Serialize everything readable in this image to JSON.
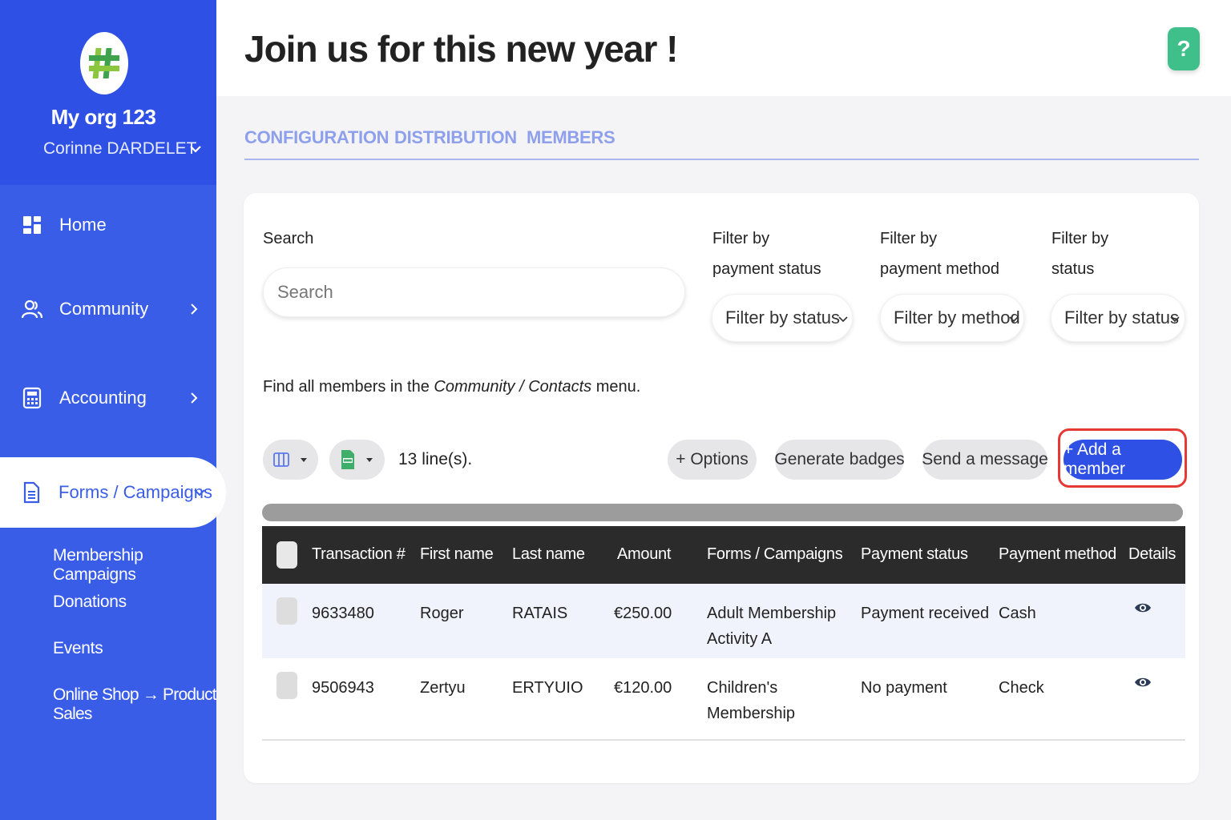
{
  "sidebar": {
    "org_name": "My org 123",
    "user_name": "Corinne DARDELET",
    "items": [
      {
        "label": "Home",
        "icon": "grid-icon"
      },
      {
        "label": "Community",
        "icon": "users-icon"
      },
      {
        "label": "Accounting",
        "icon": "calculator-icon"
      },
      {
        "label": "Forms / Campaigns",
        "icon": "document-icon"
      }
    ],
    "sub_items": [
      "Membership Campaigns",
      "Donations",
      "Events",
      "Online Shop → Product Sales"
    ]
  },
  "header": {
    "title": "Join us for this new year !",
    "help_label": "?"
  },
  "tabs": [
    "CONFIGURATION",
    "DISTRIBUTION",
    "MEMBERS"
  ],
  "filters": {
    "search_label": "Search",
    "search_placeholder": "Search",
    "payment_status_label_1": "Filter by",
    "payment_status_label_2": "payment status",
    "payment_status_value": "Filter by status",
    "payment_method_label_1": "Filter by",
    "payment_method_label_2": "payment method",
    "payment_method_value": "Filter by method",
    "status_label_1": "Filter by",
    "status_label_2": "status",
    "status_value": "Filter by status"
  },
  "info": {
    "prefix": "Find all members in the ",
    "link": "Community / Contacts",
    "suffix": " menu."
  },
  "toolbar": {
    "line_count": "13 line(s).",
    "options_label": "+ Options",
    "badges_label": "Generate badges",
    "message_label": "Send a message",
    "add_member_label": "+ Add a member"
  },
  "table": {
    "columns": [
      "Transaction #",
      "First name",
      "Last name",
      "Amount",
      "Forms / Campaigns",
      "Payment status",
      "Payment method",
      "Details"
    ],
    "rows": [
      {
        "transaction": "9633480",
        "first_name": "Roger",
        "last_name": "RATAIS",
        "amount": "€250.00",
        "campaign_1": "Adult Membership",
        "campaign_2": "Activity A",
        "payment_status": "Payment received",
        "payment_method": "Cash"
      },
      {
        "transaction": "9506943",
        "first_name": "Zertyu",
        "last_name": "ERTYUIO",
        "amount": "€120.00",
        "campaign_1": "Children's",
        "campaign_2": "Membership",
        "payment_status": "No payment",
        "payment_method": "Check"
      }
    ]
  },
  "colors": {
    "sidebar": "#3a5de8",
    "primary": "#2f50e4",
    "help": "#3fbf8a",
    "highlight": "#e53935",
    "table_header": "#2b2b2b"
  }
}
